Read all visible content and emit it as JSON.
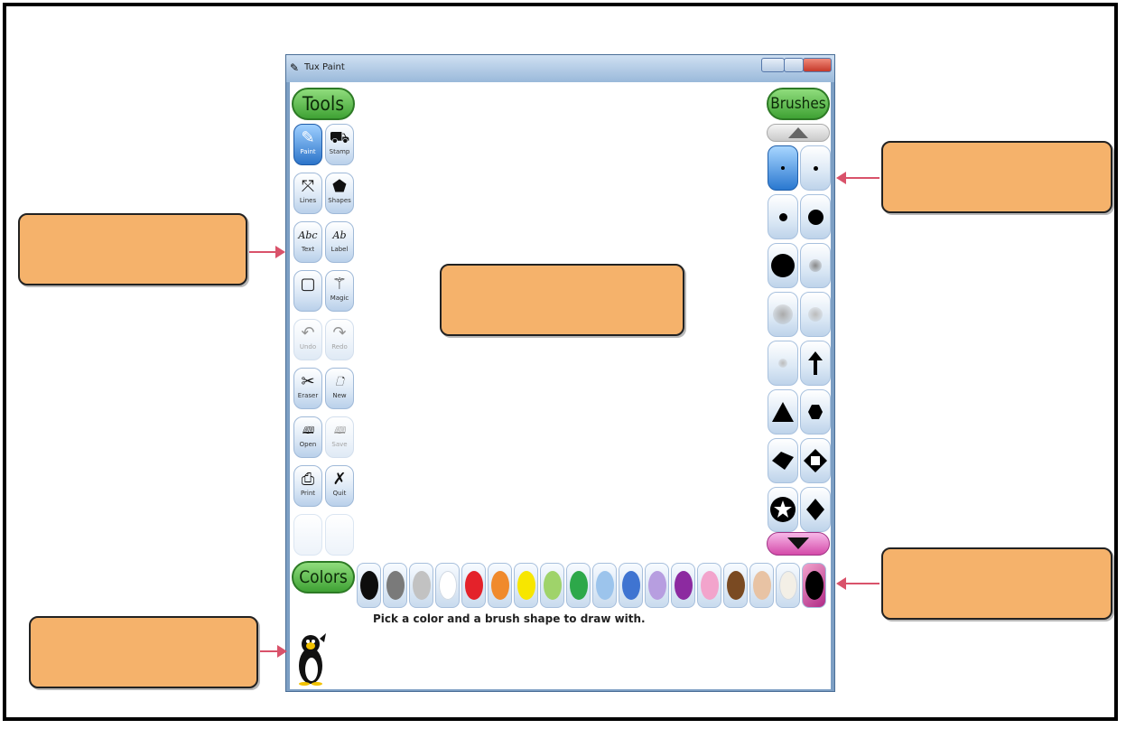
{
  "window": {
    "title": "Tux Paint",
    "app_icon": "tux-paint-app-icon"
  },
  "panels": {
    "tools": "Tools",
    "brushes": "Brushes",
    "colors": "Colors"
  },
  "tools": [
    {
      "label": "Paint",
      "icon": "paintbrush-icon",
      "glyph": "✎",
      "selected": true
    },
    {
      "label": "Stamp",
      "icon": "stamp-icon",
      "glyph": "⛟"
    },
    {
      "label": "Lines",
      "icon": "lines-icon",
      "glyph": "⤧"
    },
    {
      "label": "Shapes",
      "icon": "pentagon-icon",
      "glyph": "⬟"
    },
    {
      "label": "Text",
      "icon": "text-icon",
      "glyph": "Abc"
    },
    {
      "label": "Label",
      "icon": "label-icon",
      "glyph": "Ab"
    },
    {
      "label": "",
      "icon": "fill-box-icon",
      "glyph": "▢"
    },
    {
      "label": "Magic",
      "icon": "magic-wand-icon",
      "glyph": "⚚"
    },
    {
      "label": "Undo",
      "icon": "undo-icon",
      "glyph": "↶",
      "disabled": true
    },
    {
      "label": "Redo",
      "icon": "redo-icon",
      "glyph": "↷",
      "disabled": true
    },
    {
      "label": "Eraser",
      "icon": "eraser-icon",
      "glyph": "✂"
    },
    {
      "label": "New",
      "icon": "new-page-icon",
      "glyph": "🗋"
    },
    {
      "label": "Open",
      "icon": "open-book-icon",
      "glyph": "🕮"
    },
    {
      "label": "Save",
      "icon": "save-book-icon",
      "glyph": "🕮",
      "disabled": true
    },
    {
      "label": "Print",
      "icon": "printer-icon",
      "glyph": "⎙"
    },
    {
      "label": "Quit",
      "icon": "quit-x-icon",
      "glyph": "✗"
    }
  ],
  "brushes": [
    {
      "icon": "brush-tiny-dot-icon",
      "selected": true
    },
    {
      "icon": "brush-small-dot-icon"
    },
    {
      "icon": "brush-medium-dot-icon"
    },
    {
      "icon": "brush-large-dot-icon"
    },
    {
      "icon": "brush-xlarge-dot-icon"
    },
    {
      "icon": "brush-fuzzy-small-icon"
    },
    {
      "icon": "brush-fuzzy-large-icon"
    },
    {
      "icon": "brush-fuzzy-medium-icon"
    },
    {
      "icon": "brush-fuzzy-tiny-icon"
    },
    {
      "icon": "brush-arrow-up-icon"
    },
    {
      "icon": "brush-triangle-icon"
    },
    {
      "icon": "brush-hexagon-icon"
    },
    {
      "icon": "brush-diamond-arrow-icon"
    },
    {
      "icon": "brush-octagon-ring-icon"
    },
    {
      "icon": "brush-star-ring-icon"
    },
    {
      "icon": "brush-diamond-icon"
    }
  ],
  "colors": [
    "#0d0d0d",
    "#7a7a7a",
    "#c2c2c2",
    "#ffffff",
    "#e4222a",
    "#f08a2c",
    "#f7e600",
    "#9fd36a",
    "#2da84a",
    "#9cc4ec",
    "#3f74d1",
    "#b79ee0",
    "#8c2aa0",
    "#f2a4cc",
    "#7a4a22",
    "#e8c3a4",
    "#f3efe6",
    "#000000"
  ],
  "status_text": "Pick a color and a brush shape to draw with."
}
